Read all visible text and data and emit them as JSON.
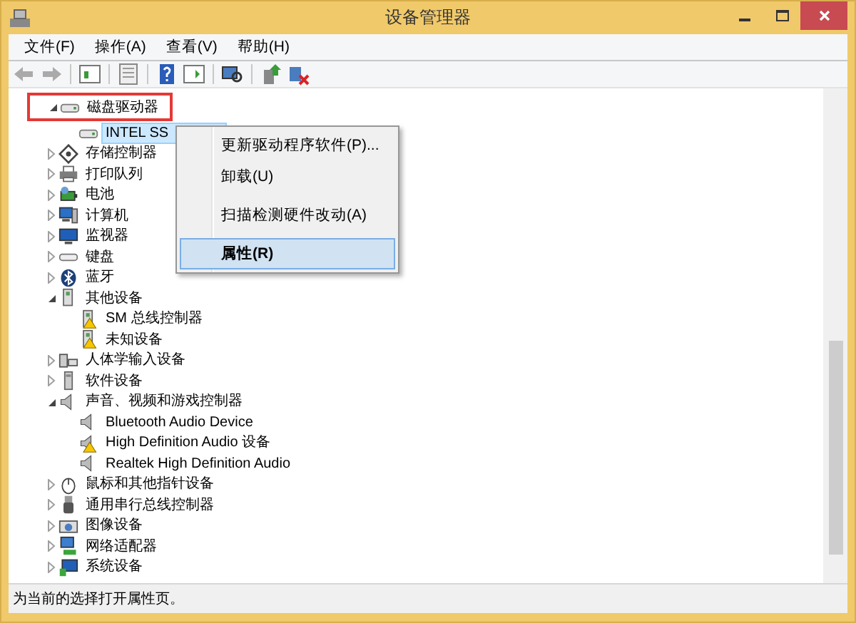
{
  "window": {
    "title": "设备管理器"
  },
  "menu_bar": [
    "文件(F)",
    "操作(A)",
    "查看(V)",
    "帮助(H)"
  ],
  "tree": [
    {
      "label": "磁盘驱动器",
      "kind": "disk",
      "expanded": true,
      "highlighted": true,
      "selected": false,
      "children": [
        {
          "label": "INTEL SS",
          "kind": "disk",
          "selected": true
        }
      ]
    },
    {
      "label": "存储控制器",
      "kind": "storage",
      "expanded": false,
      "selected": false
    },
    {
      "label": "打印队列",
      "kind": "printer",
      "expanded": false,
      "selected": false
    },
    {
      "label": "电池",
      "kind": "battery",
      "expanded": false,
      "selected": false
    },
    {
      "label": "计算机",
      "kind": "computer",
      "expanded": false,
      "selected": false
    },
    {
      "label": "监视器",
      "kind": "monitor",
      "expanded": false,
      "selected": false
    },
    {
      "label": "键盘",
      "kind": "keyboard",
      "expanded": false,
      "selected": false
    },
    {
      "label": "蓝牙",
      "kind": "bluetooth",
      "expanded": false,
      "selected": false
    },
    {
      "label": "其他设备",
      "kind": "other",
      "expanded": true,
      "selected": false,
      "children": [
        {
          "label": "SM 总线控制器",
          "kind": "other",
          "warning": true,
          "selected": false
        },
        {
          "label": "未知设备",
          "kind": "other",
          "warning": true,
          "selected": false
        }
      ]
    },
    {
      "label": "人体学输入设备",
      "kind": "hid",
      "expanded": false,
      "selected": false
    },
    {
      "label": "软件设备",
      "kind": "software",
      "expanded": false,
      "selected": false
    },
    {
      "label": "声音、视频和游戏控制器",
      "kind": "sound",
      "expanded": true,
      "selected": false,
      "children": [
        {
          "label": "Bluetooth Audio Device",
          "kind": "sound",
          "warning": false,
          "selected": false
        },
        {
          "label": "High Definition Audio 设备",
          "kind": "sound",
          "warning": true,
          "selected": false
        },
        {
          "label": "Realtek High Definition Audio",
          "kind": "sound",
          "warning": false,
          "selected": false
        }
      ]
    },
    {
      "label": "鼠标和其他指针设备",
      "kind": "mouse",
      "expanded": false,
      "selected": false
    },
    {
      "label": "通用串行总线控制器",
      "kind": "usb",
      "expanded": false,
      "selected": false
    },
    {
      "label": "图像设备",
      "kind": "camera",
      "expanded": false,
      "selected": false
    },
    {
      "label": "网络适配器",
      "kind": "network",
      "expanded": false,
      "selected": false
    },
    {
      "label": "系统设备",
      "kind": "system",
      "expanded": false,
      "selected": false
    }
  ],
  "context_menu": {
    "items": [
      {
        "label": "更新驱动程序软件(P)...",
        "selected": false,
        "separator_after": false
      },
      {
        "label": "卸载(U)",
        "selected": false,
        "separator_after": true
      },
      {
        "label": "扫描检测硬件改动(A)",
        "selected": false,
        "separator_after": true
      },
      {
        "label": "属性(R)",
        "selected": true,
        "separator_after": false
      }
    ]
  },
  "status_bar": "为当前的选择打开属性页。"
}
